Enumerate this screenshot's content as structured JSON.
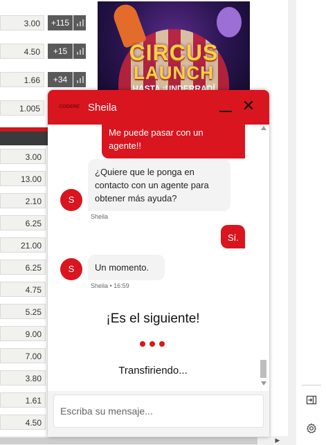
{
  "odds": {
    "top_rows": [
      {
        "value": "3.00",
        "more": "+115"
      },
      {
        "value": "4.50",
        "more": "+15"
      },
      {
        "value": "1.66",
        "more": "+34"
      },
      {
        "value": "1.005",
        "more": ""
      }
    ],
    "list": [
      "3.00",
      "13.00",
      "2.10",
      "6.25",
      "21.00",
      "6.25",
      "4.75",
      "5.25",
      "9.00",
      "7.00",
      "3.80",
      "1.61",
      "4.50"
    ]
  },
  "banner": {
    "line1": "CIRCUS",
    "line2": "LAUNCH",
    "line3": "HASTA ¡UNDERRADÍ"
  },
  "chat": {
    "agent_name": "Sheila",
    "brand_text": "CODERE",
    "messages": {
      "out1": "Me puede pasar con un agente!!",
      "in1": "¿Quiere que le ponga en contacto con un agente para obtener más ayuda?",
      "in1_meta": "Sheila",
      "out2": "Sí.",
      "in2": "Un momento.",
      "in2_meta": "Sheila • 16:59"
    },
    "avatar_letter": "S",
    "queue_status": "¡Es el siguiente!",
    "transfer_status": "Transfiriendo...",
    "input_placeholder": "Escriba su mensaje..."
  },
  "colors": {
    "accent": "#d9151f",
    "odds_bg": "#f1f1ee",
    "more_bg": "#5a5a5a"
  },
  "icons": {
    "minimize": "minimize-icon",
    "close": "close-icon",
    "panel": "panel-toggle-icon",
    "settings": "gear-icon"
  }
}
